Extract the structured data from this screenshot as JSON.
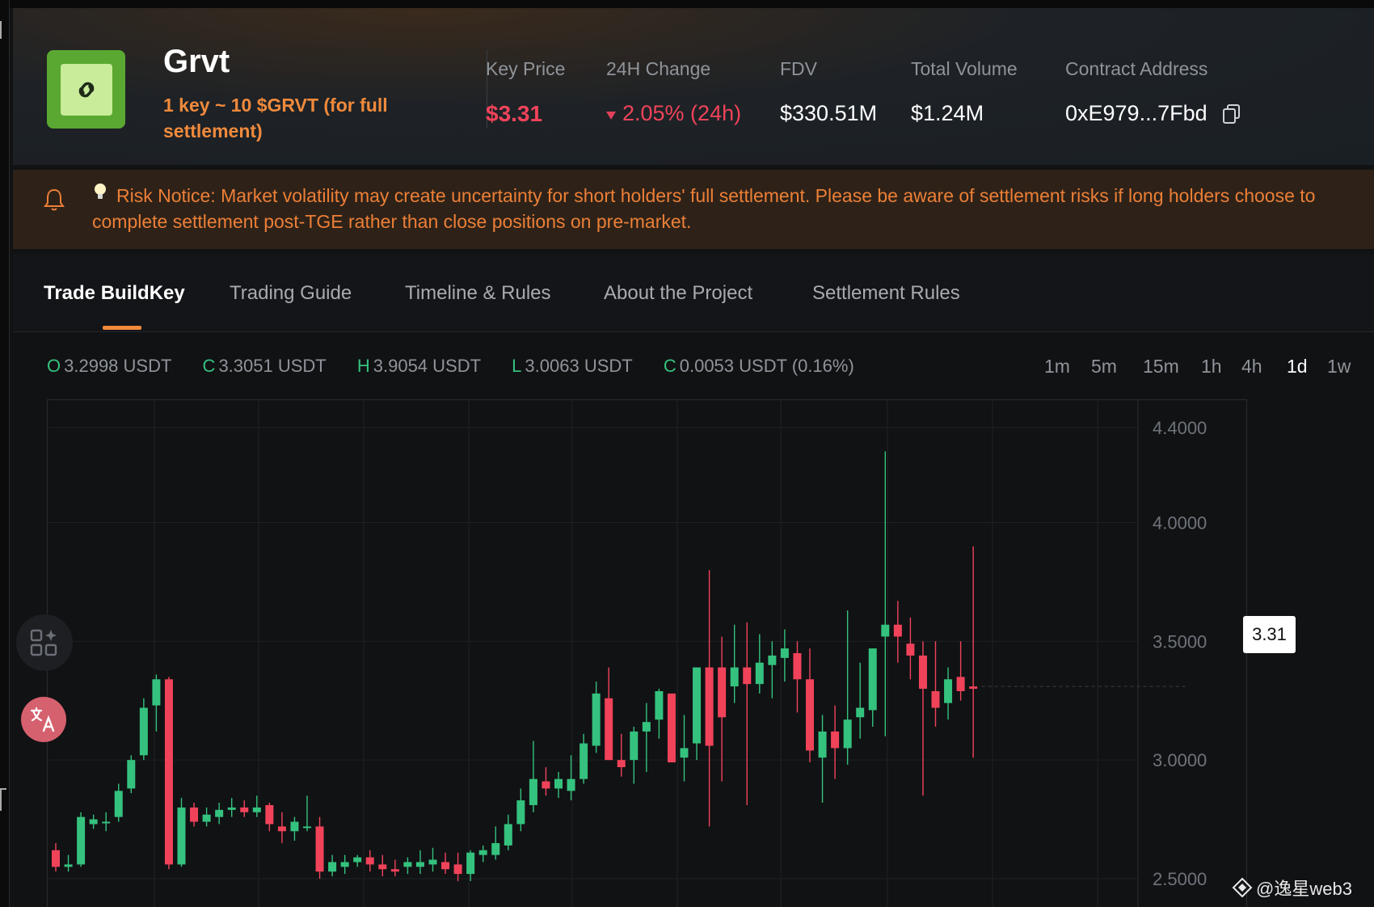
{
  "project": {
    "name": "Grvt",
    "subtitle": "1 key ~ 10 $GRVT (for full settlement)",
    "logo_color": "#5aa832"
  },
  "stats": {
    "key_price": {
      "label": "Key Price",
      "value": "$3.31"
    },
    "change_24h": {
      "label": "24H Change",
      "value": "2.05% (24h)"
    },
    "fdv": {
      "label": "FDV",
      "value": "$330.51M"
    },
    "total_volume": {
      "label": "Total Volume",
      "value": "$1.24M"
    },
    "contract": {
      "label": "Contract Address",
      "value": "0xE979...7Fbd"
    }
  },
  "risk_notice": "Risk Notice: Market volatility may create uncertainty for short holders' full settlement. Please be aware of settlement risks if long holders choose to complete settlement post-TGE rather than close positions on pre-market.",
  "tabs": [
    {
      "label": "Trade BuildKey",
      "active": true
    },
    {
      "label": "Trading Guide",
      "active": false
    },
    {
      "label": "Timeline & Rules",
      "active": false
    },
    {
      "label": "About the Project",
      "active": false
    },
    {
      "label": "Settlement Rules",
      "active": false
    }
  ],
  "ohlc": {
    "open": {
      "key": "O",
      "value": "3.2998 USDT"
    },
    "close": {
      "key": "C",
      "value": "3.3051 USDT"
    },
    "high": {
      "key": "H",
      "value": "3.9054 USDT"
    },
    "low": {
      "key": "L",
      "value": "3.0063 USDT"
    },
    "change": {
      "key": "C",
      "value": "0.0053 USDT (0.16%)"
    }
  },
  "intervals": [
    {
      "label": "1m",
      "active": false
    },
    {
      "label": "5m",
      "active": false
    },
    {
      "label": "15m",
      "active": false
    },
    {
      "label": "1h",
      "active": false
    },
    {
      "label": "4h",
      "active": false
    },
    {
      "label": "1d",
      "active": true
    },
    {
      "label": "1w",
      "active": false
    }
  ],
  "colors": {
    "up": "#34c27e",
    "down": "#f0435a",
    "accent": "#f08a3c"
  },
  "chart_data": {
    "type": "candlestick",
    "y_ticks": [
      "4.4000",
      "4.0000",
      "3.5000",
      "3.0000",
      "2.5000"
    ],
    "ylim": [
      2.3,
      4.55
    ],
    "current_price": "3.31",
    "candles": [
      {
        "o": 2.62,
        "h": 2.65,
        "l": 2.53,
        "c": 2.55
      },
      {
        "o": 2.55,
        "h": 2.6,
        "l": 2.53,
        "c": 2.56
      },
      {
        "o": 2.56,
        "h": 2.78,
        "l": 2.55,
        "c": 2.76
      },
      {
        "o": 2.73,
        "h": 2.77,
        "l": 2.71,
        "c": 2.75
      },
      {
        "o": 2.74,
        "h": 2.78,
        "l": 2.7,
        "c": 2.74
      },
      {
        "o": 2.76,
        "h": 2.9,
        "l": 2.74,
        "c": 2.87
      },
      {
        "o": 2.88,
        "h": 3.02,
        "l": 2.86,
        "c": 3.0
      },
      {
        "o": 3.02,
        "h": 3.26,
        "l": 3.0,
        "c": 3.22
      },
      {
        "o": 3.23,
        "h": 3.36,
        "l": 3.12,
        "c": 3.34
      },
      {
        "o": 3.34,
        "h": 3.35,
        "l": 2.54,
        "c": 2.56
      },
      {
        "o": 2.56,
        "h": 2.84,
        "l": 2.55,
        "c": 2.8
      },
      {
        "o": 2.8,
        "h": 2.82,
        "l": 2.72,
        "c": 2.74
      },
      {
        "o": 2.74,
        "h": 2.8,
        "l": 2.72,
        "c": 2.77
      },
      {
        "o": 2.76,
        "h": 2.82,
        "l": 2.73,
        "c": 2.79
      },
      {
        "o": 2.79,
        "h": 2.84,
        "l": 2.76,
        "c": 2.8
      },
      {
        "o": 2.8,
        "h": 2.83,
        "l": 2.76,
        "c": 2.78
      },
      {
        "o": 2.78,
        "h": 2.85,
        "l": 2.76,
        "c": 2.8
      },
      {
        "o": 2.81,
        "h": 2.82,
        "l": 2.7,
        "c": 2.73
      },
      {
        "o": 2.72,
        "h": 2.78,
        "l": 2.65,
        "c": 2.7
      },
      {
        "o": 2.7,
        "h": 2.76,
        "l": 2.66,
        "c": 2.74
      },
      {
        "o": 2.72,
        "h": 2.85,
        "l": 2.7,
        "c": 2.72
      },
      {
        "o": 2.72,
        "h": 2.76,
        "l": 2.5,
        "c": 2.53
      },
      {
        "o": 2.53,
        "h": 2.6,
        "l": 2.51,
        "c": 2.57
      },
      {
        "o": 2.55,
        "h": 2.6,
        "l": 2.52,
        "c": 2.57
      },
      {
        "o": 2.57,
        "h": 2.6,
        "l": 2.55,
        "c": 2.59
      },
      {
        "o": 2.59,
        "h": 2.62,
        "l": 2.53,
        "c": 2.56
      },
      {
        "o": 2.56,
        "h": 2.6,
        "l": 2.51,
        "c": 2.54
      },
      {
        "o": 2.54,
        "h": 2.58,
        "l": 2.51,
        "c": 2.53
      },
      {
        "o": 2.55,
        "h": 2.59,
        "l": 2.52,
        "c": 2.57
      },
      {
        "o": 2.55,
        "h": 2.62,
        "l": 2.52,
        "c": 2.57
      },
      {
        "o": 2.56,
        "h": 2.63,
        "l": 2.53,
        "c": 2.58
      },
      {
        "o": 2.57,
        "h": 2.61,
        "l": 2.52,
        "c": 2.54
      },
      {
        "o": 2.56,
        "h": 2.61,
        "l": 2.49,
        "c": 2.52
      },
      {
        "o": 2.52,
        "h": 2.62,
        "l": 2.49,
        "c": 2.61
      },
      {
        "o": 2.6,
        "h": 2.64,
        "l": 2.57,
        "c": 2.62
      },
      {
        "o": 2.6,
        "h": 2.72,
        "l": 2.58,
        "c": 2.65
      },
      {
        "o": 2.64,
        "h": 2.77,
        "l": 2.62,
        "c": 2.73
      },
      {
        "o": 2.73,
        "h": 2.88,
        "l": 2.7,
        "c": 2.83
      },
      {
        "o": 2.81,
        "h": 3.08,
        "l": 2.78,
        "c": 2.92
      },
      {
        "o": 2.91,
        "h": 2.97,
        "l": 2.85,
        "c": 2.88
      },
      {
        "o": 2.88,
        "h": 2.95,
        "l": 2.84,
        "c": 2.92
      },
      {
        "o": 2.87,
        "h": 3.02,
        "l": 2.83,
        "c": 2.92
      },
      {
        "o": 2.92,
        "h": 3.11,
        "l": 2.9,
        "c": 3.07
      },
      {
        "o": 3.06,
        "h": 3.33,
        "l": 3.03,
        "c": 3.28
      },
      {
        "o": 3.26,
        "h": 3.39,
        "l": 3.04,
        "c": 3.0
      },
      {
        "o": 3.0,
        "h": 3.11,
        "l": 2.93,
        "c": 2.97
      },
      {
        "o": 3.0,
        "h": 3.14,
        "l": 2.9,
        "c": 3.12
      },
      {
        "o": 3.12,
        "h": 3.24,
        "l": 2.95,
        "c": 3.16
      },
      {
        "o": 3.17,
        "h": 3.3,
        "l": 3.09,
        "c": 3.29
      },
      {
        "o": 3.28,
        "h": 3.26,
        "l": 3.06,
        "c": 2.99
      },
      {
        "o": 3.01,
        "h": 3.19,
        "l": 2.91,
        "c": 3.05
      },
      {
        "o": 3.07,
        "h": 3.26,
        "l": 3.0,
        "c": 3.39
      },
      {
        "o": 3.39,
        "h": 3.8,
        "l": 2.72,
        "c": 3.06
      },
      {
        "o": 3.39,
        "h": 3.52,
        "l": 2.91,
        "c": 3.18
      },
      {
        "o": 3.31,
        "h": 3.57,
        "l": 3.24,
        "c": 3.39
      },
      {
        "o": 3.39,
        "h": 3.58,
        "l": 2.81,
        "c": 3.32
      },
      {
        "o": 3.32,
        "h": 3.53,
        "l": 3.28,
        "c": 3.41
      },
      {
        "o": 3.4,
        "h": 3.5,
        "l": 3.26,
        "c": 3.44
      },
      {
        "o": 3.43,
        "h": 3.55,
        "l": 3.33,
        "c": 3.47
      },
      {
        "o": 3.45,
        "h": 3.5,
        "l": 3.2,
        "c": 3.34
      },
      {
        "o": 3.34,
        "h": 3.47,
        "l": 2.99,
        "c": 3.04
      },
      {
        "o": 3.01,
        "h": 3.19,
        "l": 2.82,
        "c": 3.12
      },
      {
        "o": 3.12,
        "h": 3.23,
        "l": 2.92,
        "c": 3.05
      },
      {
        "o": 3.05,
        "h": 3.63,
        "l": 2.98,
        "c": 3.17
      },
      {
        "o": 3.18,
        "h": 3.41,
        "l": 3.09,
        "c": 3.22
      },
      {
        "o": 3.21,
        "h": 3.32,
        "l": 3.14,
        "c": 3.47
      },
      {
        "o": 3.52,
        "h": 4.3,
        "l": 3.1,
        "c": 3.57
      },
      {
        "o": 3.57,
        "h": 3.67,
        "l": 3.41,
        "c": 3.52
      },
      {
        "o": 3.49,
        "h": 3.6,
        "l": 3.34,
        "c": 3.44
      },
      {
        "o": 3.44,
        "h": 3.5,
        "l": 2.85,
        "c": 3.3
      },
      {
        "o": 3.29,
        "h": 3.5,
        "l": 3.14,
        "c": 3.22
      },
      {
        "o": 3.24,
        "h": 3.39,
        "l": 3.17,
        "c": 3.34
      },
      {
        "o": 3.35,
        "h": 3.5,
        "l": 3.25,
        "c": 3.29
      },
      {
        "o": 3.31,
        "h": 3.9,
        "l": 3.01,
        "c": 3.3
      }
    ]
  },
  "watermark": "@逸星web3"
}
